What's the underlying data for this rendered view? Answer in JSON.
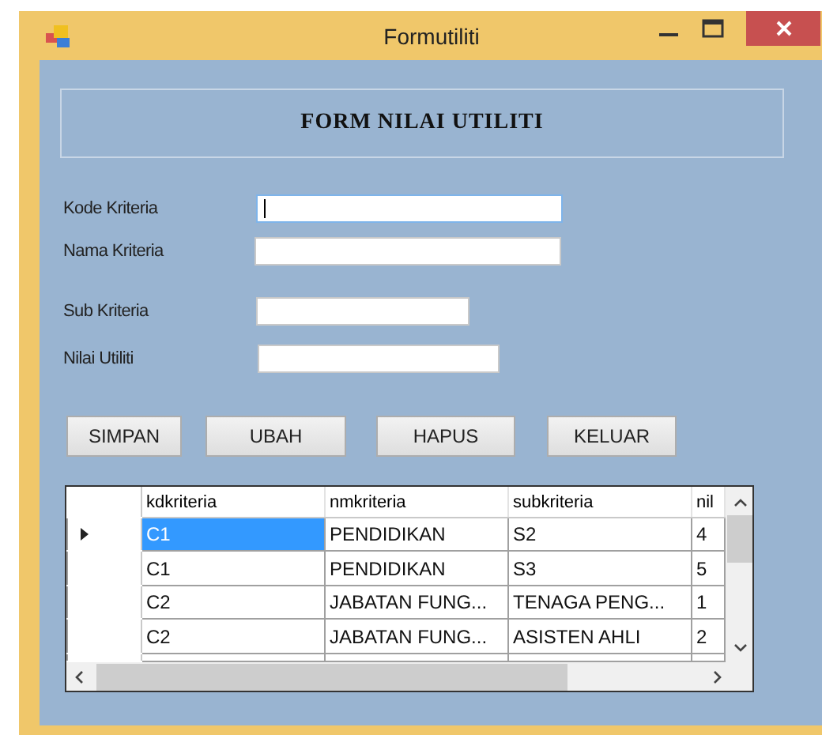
{
  "window": {
    "title": "Formutiliti"
  },
  "header": "FORM NILAI UTILITI",
  "fields": [
    {
      "label": "Kode Kriteria",
      "focused": true
    },
    {
      "label": "Nama Kriteria",
      "focused": false
    },
    {
      "label": "Sub Kriteria",
      "focused": false
    },
    {
      "label": "Nilai Utiliti",
      "focused": false
    }
  ],
  "buttons": [
    "SIMPAN",
    "UBAH",
    "HAPUS",
    "KELUAR"
  ],
  "table": {
    "columns": [
      "kdkriteria",
      "nmkriteria",
      "subkriteria",
      "nil"
    ],
    "rows": [
      {
        "selected": true,
        "cells": [
          "C1",
          "PENDIDIKAN",
          "S2",
          "4"
        ]
      },
      {
        "selected": false,
        "cells": [
          "C1",
          "PENDIDIKAN",
          "S3",
          "5"
        ]
      },
      {
        "selected": false,
        "cells": [
          "C2",
          "JABATAN FUNG...",
          "TENAGA PENG...",
          "1"
        ]
      },
      {
        "selected": false,
        "cells": [
          "C2",
          "JABATAN FUNG...",
          "ASISTEN AHLI",
          "2"
        ]
      }
    ]
  }
}
